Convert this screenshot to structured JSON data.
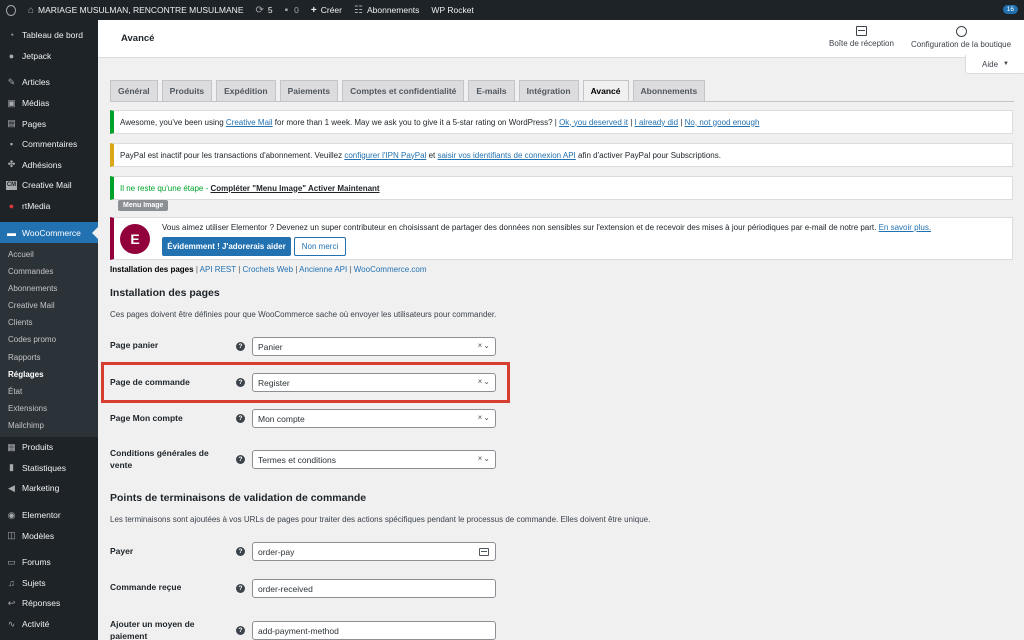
{
  "adminbar": {
    "site_name": "MARIAGE MUSULMAN, RENCONTRE MUSULMANE",
    "updates_count": "5",
    "comments_count": "0",
    "new_label": "Créer",
    "subscriptions_label": "Abonnements",
    "wp_rocket_label": "WP Rocket",
    "notifications_count": "16"
  },
  "sidebar": {
    "items_top": [
      {
        "label": "Tableau de bord",
        "icon": "dashboard-icon"
      },
      {
        "label": "Jetpack",
        "icon": "jetpack-icon"
      }
    ],
    "items_mid": [
      {
        "label": "Articles",
        "icon": "pin-icon"
      },
      {
        "label": "Médias",
        "icon": "media-icon"
      },
      {
        "label": "Pages",
        "icon": "page-icon"
      },
      {
        "label": "Commentaires",
        "icon": "comment-icon"
      },
      {
        "label": "Adhésions",
        "icon": "membership-icon"
      },
      {
        "label": "Creative Mail",
        "icon": "creative-mail-icon"
      },
      {
        "label": "rtMedia",
        "icon": "rtmedia-icon"
      }
    ],
    "woocommerce_label": "WooCommerce",
    "submenu": [
      "Accueil",
      "Commandes",
      "Abonnements",
      "Creative Mail",
      "Clients",
      "Codes promo",
      "Rapports",
      "Réglages",
      "État",
      "Extensions",
      "Mailchimp"
    ],
    "current_sub": "Réglages",
    "items_bottom": [
      {
        "label": "Produits",
        "icon": "products-icon"
      },
      {
        "label": "Statistiques",
        "icon": "stats-icon"
      },
      {
        "label": "Marketing",
        "icon": "megaphone-icon"
      }
    ],
    "items_bottom2": [
      {
        "label": "Elementor",
        "icon": "elementor-icon"
      },
      {
        "label": "Modèles",
        "icon": "templates-icon"
      }
    ],
    "items_bottom3": [
      {
        "label": "Forums",
        "icon": "forums-icon"
      },
      {
        "label": "Sujets",
        "icon": "topics-icon"
      },
      {
        "label": "Réponses",
        "icon": "replies-icon"
      },
      {
        "label": "Activité",
        "icon": "activity-icon"
      }
    ]
  },
  "header": {
    "title": "Avancé",
    "inbox_label": "Boîte de réception",
    "setup_label": "Configuration de la boutique",
    "help_label": "Aide"
  },
  "tabs": [
    {
      "label": "Général",
      "active": false
    },
    {
      "label": "Produits",
      "active": false
    },
    {
      "label": "Expédition",
      "active": false
    },
    {
      "label": "Paiements",
      "active": false
    },
    {
      "label": "Comptes et confidentialité",
      "active": false
    },
    {
      "label": "E-mails",
      "active": false
    },
    {
      "label": "Intégration",
      "active": false
    },
    {
      "label": "Avancé",
      "active": true
    },
    {
      "label": "Abonnements",
      "active": false
    }
  ],
  "notices": {
    "creative_mail": {
      "text_before": "Awesome, you've been using ",
      "link": "Creative Mail",
      "text_after": " for more than 1 week. May we ask you to give it a 5-star rating on WordPress? | ",
      "link_ok": "Ok, you deserved it",
      "sep1": " | ",
      "link_did": "I already did",
      "sep2": " | ",
      "link_no": "No, not good enough"
    },
    "paypal": {
      "text1": "PayPal est inactif pour les transactions d'abonnement. Veuillez ",
      "link1": "configurer l'IPN PayPal",
      "text2": " et ",
      "link2": "saisir vos identifiants de connexion API",
      "text3": " afin d'activer PayPal pour Subscriptions."
    },
    "menu_image": {
      "text": "Il ne reste qu'une étape - ",
      "link": "Compléter \"Menu Image\" Activer Maintenant",
      "tag": "Menu Image"
    },
    "elementor": {
      "text": "Vous aimez utiliser Elementor ? Devenez un super contributeur en choisissant de partager des données non sensibles sur l'extension et de recevoir des mises à jour périodiques par e-mail de notre part. ",
      "link": "En savoir plus.",
      "btn_yes": "Évidemment ! J'adorerais aider",
      "btn_no": "Non merci",
      "logo": "E"
    }
  },
  "subsubsub": {
    "current": "Installation des pages",
    "links": [
      "API REST",
      "Crochets Web",
      "Ancienne API",
      "WooCommerce.com"
    ]
  },
  "page_setup": {
    "title": "Installation des pages",
    "desc": "Ces pages doivent être définies pour que WooCommerce sache où envoyer les utilisateurs pour commander.",
    "fields": [
      {
        "label": "Page panier",
        "value": "Panier"
      },
      {
        "label": "Page de commande",
        "value": "Register"
      },
      {
        "label": "Page Mon compte",
        "value": "Mon compte"
      },
      {
        "label": "Conditions générales de vente",
        "value": "Termes et conditions"
      }
    ]
  },
  "endpoints": {
    "title": "Points de terminaisons de validation de commande",
    "desc": "Les terminaisons sont ajoutées à vos URLs de pages pour traiter des actions spécifiques pendant le processus de commande. Elles doivent être unique.",
    "fields": [
      {
        "label": "Payer",
        "value": "order-pay"
      },
      {
        "label": "Commande reçue",
        "value": "order-received"
      },
      {
        "label": "Ajouter un moyen de paiement",
        "value": "add-payment-method"
      }
    ]
  },
  "colors": {
    "highlight": "#d63e2f",
    "accent": "#2271b1",
    "elementor": "#92003b"
  }
}
